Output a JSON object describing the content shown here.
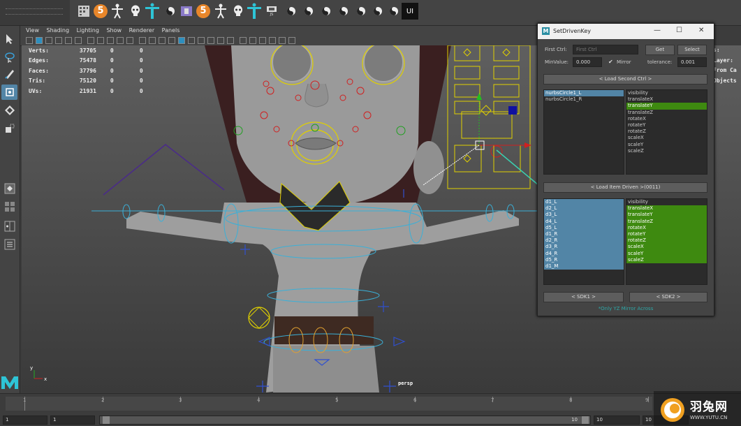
{
  "viewport": {
    "menu": [
      "View",
      "Shading",
      "Lighting",
      "Show",
      "Renderer",
      "Panels"
    ],
    "hud": [
      {
        "label": "Verts:",
        "value": "37705",
        "a": "0",
        "b": "0"
      },
      {
        "label": "Edges:",
        "value": "75478",
        "a": "0",
        "b": "0"
      },
      {
        "label": "Faces:",
        "value": "37796",
        "a": "0",
        "b": "0"
      },
      {
        "label": "Tris:",
        "value": "75120",
        "a": "0",
        "b": "0"
      },
      {
        "label": "UVs:",
        "value": "21931",
        "a": "0",
        "b": "0"
      }
    ],
    "right_hud": [
      "s:",
      "",
      "",
      "Layer:",
      "From Ca",
      "Objects"
    ],
    "camera_label": "persp",
    "axis_y": "y",
    "axis_x": "x"
  },
  "shelf": {
    "badge_5": "5",
    "ui_label": "UI",
    "js_label": "JS"
  },
  "dialog": {
    "title": "SetDrivenKey",
    "logo": "M",
    "first_ctrl_label": "First Ctrl:",
    "first_ctrl_placeholder": "First Ctrl",
    "get_label": "Get",
    "select_label": "Select",
    "min_value_label": "MinValue:",
    "min_value": "0.000",
    "mirror_label": "Mirror",
    "tolerance_label": "tolerance:",
    "tolerance": "0.001",
    "load_second_label": "< Load Second Ctrl >",
    "second_list": [
      "nurbsCircle1_L",
      "nurbsCircle1_R"
    ],
    "second_attrs": [
      "visibility",
      "translateX",
      "translateY",
      "translateZ",
      "rotateX",
      "rotateY",
      "rotateZ",
      "scaleX",
      "scaleY",
      "scaleZ"
    ],
    "load_driven_label": "< Load Item Driven >(0011)",
    "driven_list": [
      "d1_L",
      "d2_L",
      "d3_L",
      "d4_L",
      "d5_L",
      "d1_R",
      "d2_R",
      "d3_R",
      "d4_R",
      "d5_R",
      "d1_M"
    ],
    "driven_attrs": [
      "visibility",
      "translateX",
      "translateY",
      "translateZ",
      "rotateX",
      "rotateY",
      "rotateZ",
      "scaleX",
      "scaleY",
      "scaleZ"
    ],
    "sdk1_label": "< SDK1 >",
    "sdk2_label": "< SDK2 >",
    "mirror_note": "*Only YZ Mirror Across",
    "colors": {
      "selection_blue": "#5285a6",
      "selection_green": "#3e8a10",
      "note_teal": "#2ea7a7"
    }
  },
  "timeline": {
    "ticks": [
      "1",
      "2",
      "3",
      "4",
      "5",
      "6",
      "7",
      "8",
      "9"
    ],
    "current_frame": "1"
  },
  "range": {
    "start": "1",
    "start2": "1",
    "end_inner": "10",
    "end": "10",
    "end2": "10"
  },
  "watermark": {
    "cn": "羽兔网",
    "url": "WWW.YUTU.CN",
    "maya_logo": "M"
  }
}
